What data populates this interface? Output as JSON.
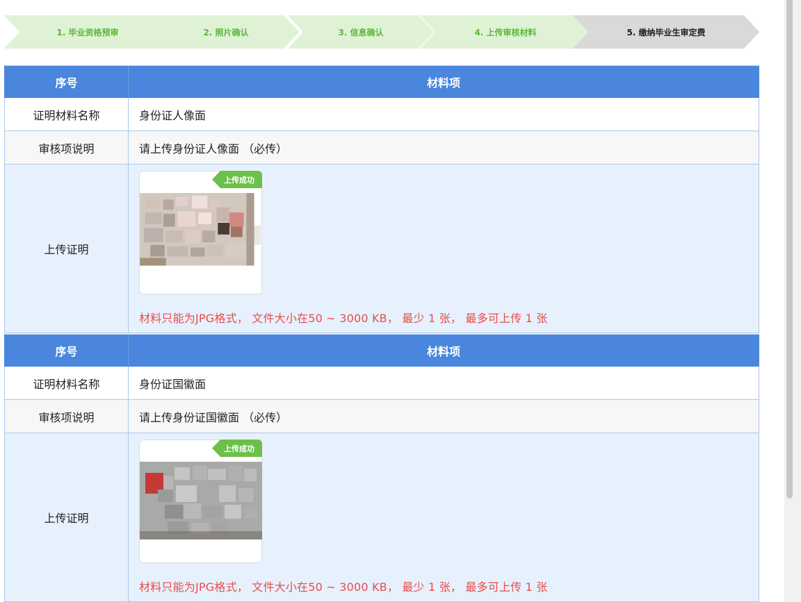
{
  "steps": [
    {
      "label": "1. 毕业资格预审",
      "state": "done"
    },
    {
      "label": "2. 照片确认",
      "state": "done"
    },
    {
      "label": "3. 信息确认",
      "state": "done"
    },
    {
      "label": "4. 上传审核材料",
      "state": "done"
    },
    {
      "label": "5. 缴纳毕业生审定费",
      "state": "current"
    }
  ],
  "colors": {
    "step_done_bg": "#dff2d6",
    "step_done_text": "#5cb83a",
    "step_current_bg": "#d9d9d9",
    "header_bg": "#4a86dd",
    "upload_bg": "#e7f1fd",
    "hint_text": "#e74c4c",
    "badge_bg": "#6cc04a"
  },
  "materials": [
    {
      "header_col1": "序号",
      "header_col2": "材料项",
      "name_label": "证明材料名称",
      "name_value": "身份证人像面",
      "desc_label": "审核项说明",
      "desc_value": "请上传身份证人像面 （必传）",
      "upload_label": "上传证明",
      "badge": "上传成功",
      "hint": "材料只能为JPG格式， 文件大小在50 ~ 3000 KB， 最少 1 张， 最多可上传 1 张"
    },
    {
      "header_col1": "序号",
      "header_col2": "材料项",
      "name_label": "证明材料名称",
      "name_value": "身份证国徽面",
      "desc_label": "审核项说明",
      "desc_value": "请上传身份证国徽面 （必传）",
      "upload_label": "上传证明",
      "badge": "上传成功",
      "hint": "材料只能为JPG格式， 文件大小在50 ~ 3000 KB， 最少 1 张， 最多可上传 1 张"
    }
  ]
}
